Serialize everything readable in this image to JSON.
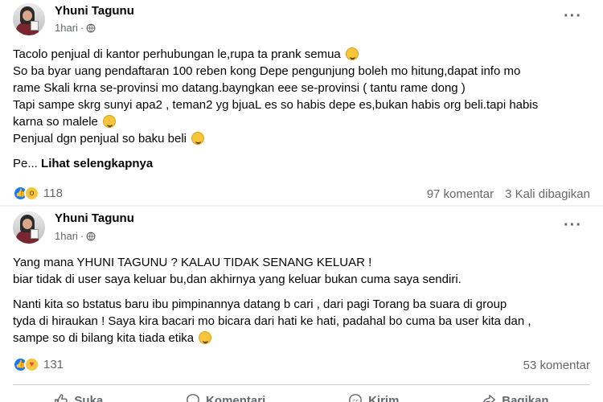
{
  "posts": [
    {
      "author": "Yhuni Tagunu",
      "time": "1hari",
      "lines": [
        "Tacolo penjual di kantor perhubungan le,rupa ta prank semua",
        "So ba byar uang pendaftaran 100 reben kong Depe pengunjung boleh mo hitung,dapat info mo",
        "rame Skali krna se-provinsi mo datang.bayngkan eee se-provinsi ( tantu rame dong )",
        "Tapi sampe skrg sunyi apa2 , teman2 yg bjuaL es so habis depe es,bukan habis org beli.tapi habis",
        "karna so malele",
        "Penjual dgn penjual so baku beli",
        "Pe...",
        "Lihat selengkapnya"
      ],
      "reaction_count": "118",
      "comments": "97 komentar",
      "shares": "3 Kali dibagikan"
    },
    {
      "author": "Yhuni Tagunu",
      "time": "1hari",
      "lines": [
        "Yang mana YHUNI TAGUNU ? KALAU TIDAK SENANG KELUAR !",
        "biar tidak di user saya keluar bu,dan akhirnya yang keluar bukan cuma saya sendiri.",
        "Nanti kita so bstatus baru ibu pimpinannya datang b cari , dari pagi Torang ba suara di group",
        "tyda di hiraukan ! Saya kira bacari mo bicara dari hati ke hati, padahal bo cuma ba user kita dan ,",
        "sampe so di bilang kita tiada etika"
      ],
      "reaction_count": "131",
      "comments": "53 komentar"
    }
  ],
  "actions": {
    "like": "Suka",
    "comment": "Komentari",
    "send": "Kirim",
    "share": "Bagikan"
  }
}
